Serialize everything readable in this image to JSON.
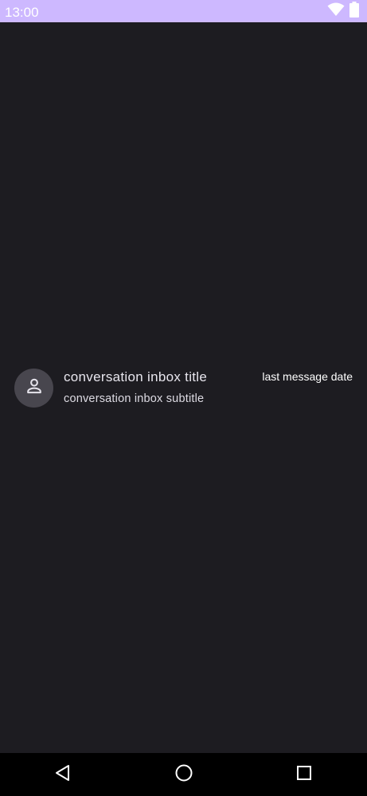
{
  "status_bar": {
    "time": "13:00",
    "icons": [
      "wifi-icon",
      "battery-icon"
    ],
    "background": "#cdb8ff"
  },
  "conversation": {
    "title": "conversation inbox title",
    "subtitle": "conversation inbox subtitle",
    "date": "last message date",
    "avatar_icon": "person-icon"
  },
  "nav_bar": {
    "buttons": [
      "back-icon",
      "home-icon",
      "recents-icon"
    ]
  },
  "colors": {
    "background": "#1d1c21",
    "avatar": "#48464e",
    "nav": "#000000"
  }
}
